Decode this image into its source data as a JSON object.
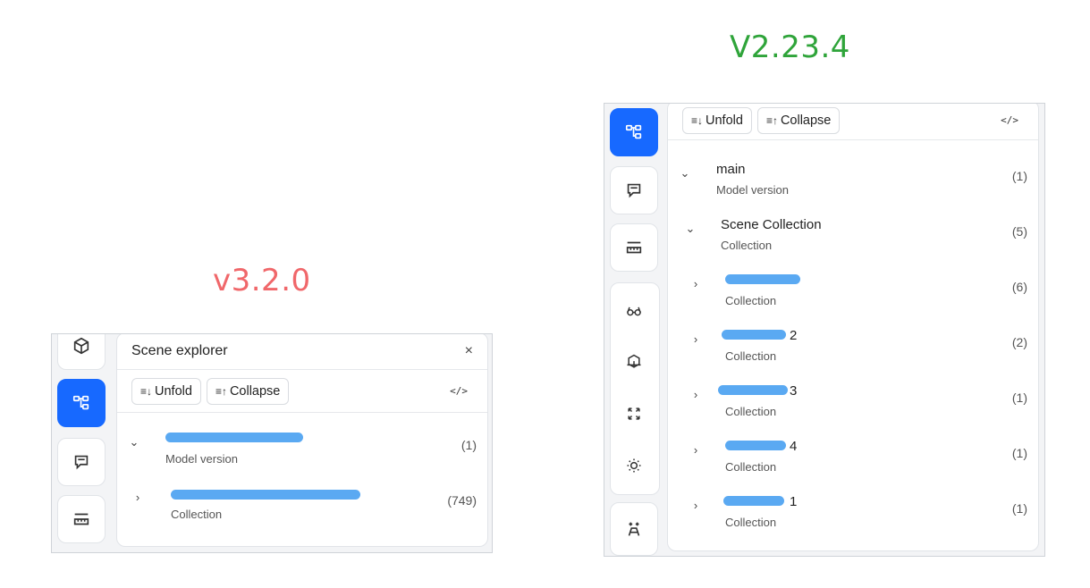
{
  "labels": {
    "old_version": "v3.2.0",
    "new_version": "V2.23.4"
  },
  "old_panel": {
    "title": "Scene explorer",
    "close_label": "×",
    "unfold_label": "Unfold",
    "collapse_label": "Collapse",
    "code_label": "</>",
    "rows": [
      {
        "name": "",
        "sub": "Model version",
        "count": "(1)",
        "expanded": true
      },
      {
        "name": "",
        "sub": "Collection",
        "count": "(749)",
        "expanded": false
      }
    ]
  },
  "new_panel": {
    "unfold_label": "Unfold",
    "collapse_label": "Collapse",
    "code_label": "</>",
    "rows": [
      {
        "name": "main",
        "sub": "Model version",
        "count": "(1)",
        "expanded": true
      },
      {
        "name": "Scene Collection",
        "sub": "Collection",
        "count": "(5)",
        "expanded": true
      },
      {
        "name": "",
        "sub": "Collection",
        "count": "(6)",
        "expanded": false
      },
      {
        "name": "2",
        "sub": "Collection",
        "count": "(2)",
        "expanded": false
      },
      {
        "name": "3",
        "sub": "Collection",
        "count": "(1)",
        "expanded": false
      },
      {
        "name": "4",
        "sub": "Collection",
        "count": "(1)",
        "expanded": false
      },
      {
        "name": "1",
        "sub": "Collection",
        "count": "(1)",
        "expanded": false
      }
    ]
  },
  "icons": {
    "unfold": "unfold-icon",
    "collapse": "collapse-icon",
    "chevron_down": "chevron-down-icon",
    "chevron_right": "chevron-right-icon"
  },
  "colors": {
    "accent": "#1769ff",
    "old_label": "#f0676a",
    "new_label": "#2fa43a",
    "redaction": "#5aa9f2"
  }
}
